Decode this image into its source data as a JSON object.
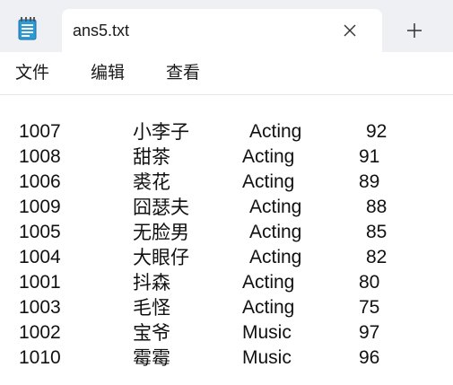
{
  "tab": {
    "title": "ans5.txt",
    "close_icon": "close-icon",
    "new_tab_icon": "plus-icon"
  },
  "app_icon": "notepad-icon",
  "menu": [
    "文件",
    "编辑",
    "查看"
  ],
  "rows": [
    {
      "id": "1007",
      "name": "小李子",
      "subject": "Acting",
      "score": "92"
    },
    {
      "id": "1008",
      "name": "甜茶",
      "subject": "Acting",
      "score": "91"
    },
    {
      "id": "1006",
      "name": "裘花",
      "subject": "Acting",
      "score": "89"
    },
    {
      "id": "1009",
      "name": "囧瑟夫",
      "subject": "Acting",
      "score": "88"
    },
    {
      "id": "1005",
      "name": "无脸男",
      "subject": "Acting",
      "score": "85"
    },
    {
      "id": "1004",
      "name": "大眼仔",
      "subject": "Acting",
      "score": "82"
    },
    {
      "id": "1001",
      "name": "抖森",
      "subject": "Acting",
      "score": "80"
    },
    {
      "id": "1003",
      "name": "毛怪",
      "subject": "Acting",
      "score": "75"
    },
    {
      "id": "1002",
      "name": "宝爷",
      "subject": "Music",
      "score": "97"
    },
    {
      "id": "1010",
      "name": "霉霉",
      "subject": "Music",
      "score": "96"
    }
  ],
  "colors": {
    "titlebar": "#eef0f3",
    "text": "#111111",
    "icon_blue": "#2b9bd8"
  }
}
